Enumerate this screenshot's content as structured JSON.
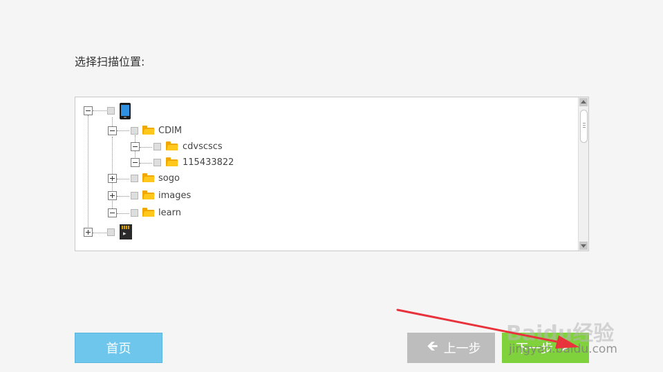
{
  "prompt": {
    "label": "选择扫描位置:"
  },
  "tree": {
    "nodes": [
      {
        "id": "device-root",
        "label": "",
        "icon": "phone-icon",
        "expanded": true
      },
      {
        "id": "cdim",
        "label": "CDIM",
        "icon": "folder-icon",
        "expanded": true
      },
      {
        "id": "cdvscscs",
        "label": "cdvscscs",
        "icon": "folder-icon",
        "expanded": true
      },
      {
        "id": "115433822",
        "label": "115433822",
        "icon": "folder-icon",
        "expanded": true
      },
      {
        "id": "sogo",
        "label": "sogo",
        "icon": "folder-icon",
        "expanded": false
      },
      {
        "id": "images",
        "label": "images",
        "icon": "folder-icon",
        "expanded": false
      },
      {
        "id": "learn",
        "label": "learn",
        "icon": "folder-icon",
        "expanded": true
      },
      {
        "id": "sdcard-root",
        "label": "",
        "icon": "sd-card-icon",
        "expanded": false
      }
    ]
  },
  "buttons": {
    "home": "首页",
    "prev": "上一步",
    "next": "下一步"
  },
  "watermark": {
    "logo": "Baidu经验",
    "url": "jingyan.baidu.com"
  },
  "colors": {
    "home_button": "#6ec6ec",
    "prev_button": "#bdbdbd",
    "next_button": "#80d23c",
    "folder": "#ffc81a",
    "annotation_arrow": "#e8323c"
  }
}
